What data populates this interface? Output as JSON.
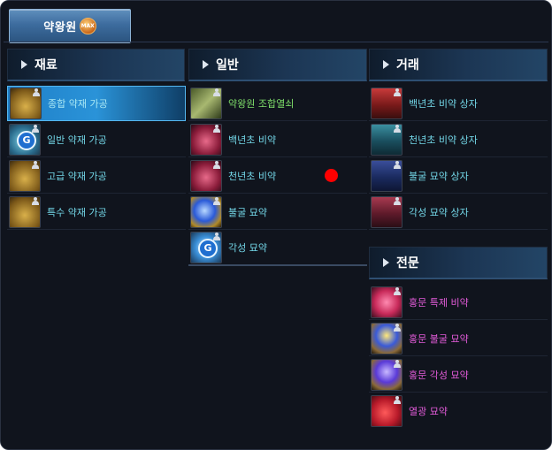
{
  "title_tab": {
    "label": "약왕원",
    "badge": "MAX"
  },
  "columns": [
    {
      "header": "재료",
      "items": [
        {
          "label": "종합 약재 가공",
          "color": "white-cyan",
          "icon": "herb-bundle-icon",
          "selected": true
        },
        {
          "label": "일반 약재 가공",
          "color": "cyan",
          "icon": "g-orb-icon"
        },
        {
          "label": "고급 약재 가공",
          "color": "cyan",
          "icon": "herb-bundle-icon"
        },
        {
          "label": "특수 약재 가공",
          "color": "cyan",
          "icon": "herb-bundle-icon"
        }
      ]
    },
    {
      "header": "일반",
      "items": [
        {
          "label": "약왕원 조합열쇠",
          "color": "green",
          "icon": "golden-key-icon"
        },
        {
          "label": "백년초 비약",
          "color": "cyan",
          "icon": "red-potion-icon"
        },
        {
          "label": "천년초 비약",
          "color": "cyan",
          "icon": "red-potion-icon"
        },
        {
          "label": "불굴 묘약",
          "color": "cyan",
          "icon": "blue-orb-icon"
        },
        {
          "label": "각성 묘약",
          "color": "cyan",
          "icon": "g-orb-icon"
        }
      ]
    },
    {
      "header": "거래",
      "items": [
        {
          "label": "백년초 비약 상자",
          "color": "cyan",
          "icon": "red-chest-icon"
        },
        {
          "label": "천년초 비약 상자",
          "color": "cyan",
          "icon": "teal-chest-icon"
        },
        {
          "label": "불굴 묘약 상자",
          "color": "cyan",
          "icon": "navy-chest-icon"
        },
        {
          "label": "각성 묘약 상자",
          "color": "cyan",
          "icon": "maroon-chest-icon"
        }
      ]
    },
    {
      "header": "전문",
      "items": [
        {
          "label": "홍문 특제 비약",
          "color": "purple",
          "icon": "pink-heart-potion-icon"
        },
        {
          "label": "홍문 불굴 묘약",
          "color": "purple",
          "icon": "lamp-orb-icon"
        },
        {
          "label": "홍문 각성 묘약",
          "color": "purple",
          "icon": "purple-orb-icon"
        },
        {
          "label": "열광 묘약",
          "color": "purple",
          "icon": "red-apple-icon"
        }
      ]
    }
  ],
  "colors": {
    "background": "#10141d",
    "tab_blue": "#3d6c9e",
    "selected_row": "#2a93d8",
    "text_cyan": "#73d7e8",
    "text_green": "#7fe06a",
    "text_purple": "#e35bd9",
    "marker_red": "#ff0000"
  }
}
